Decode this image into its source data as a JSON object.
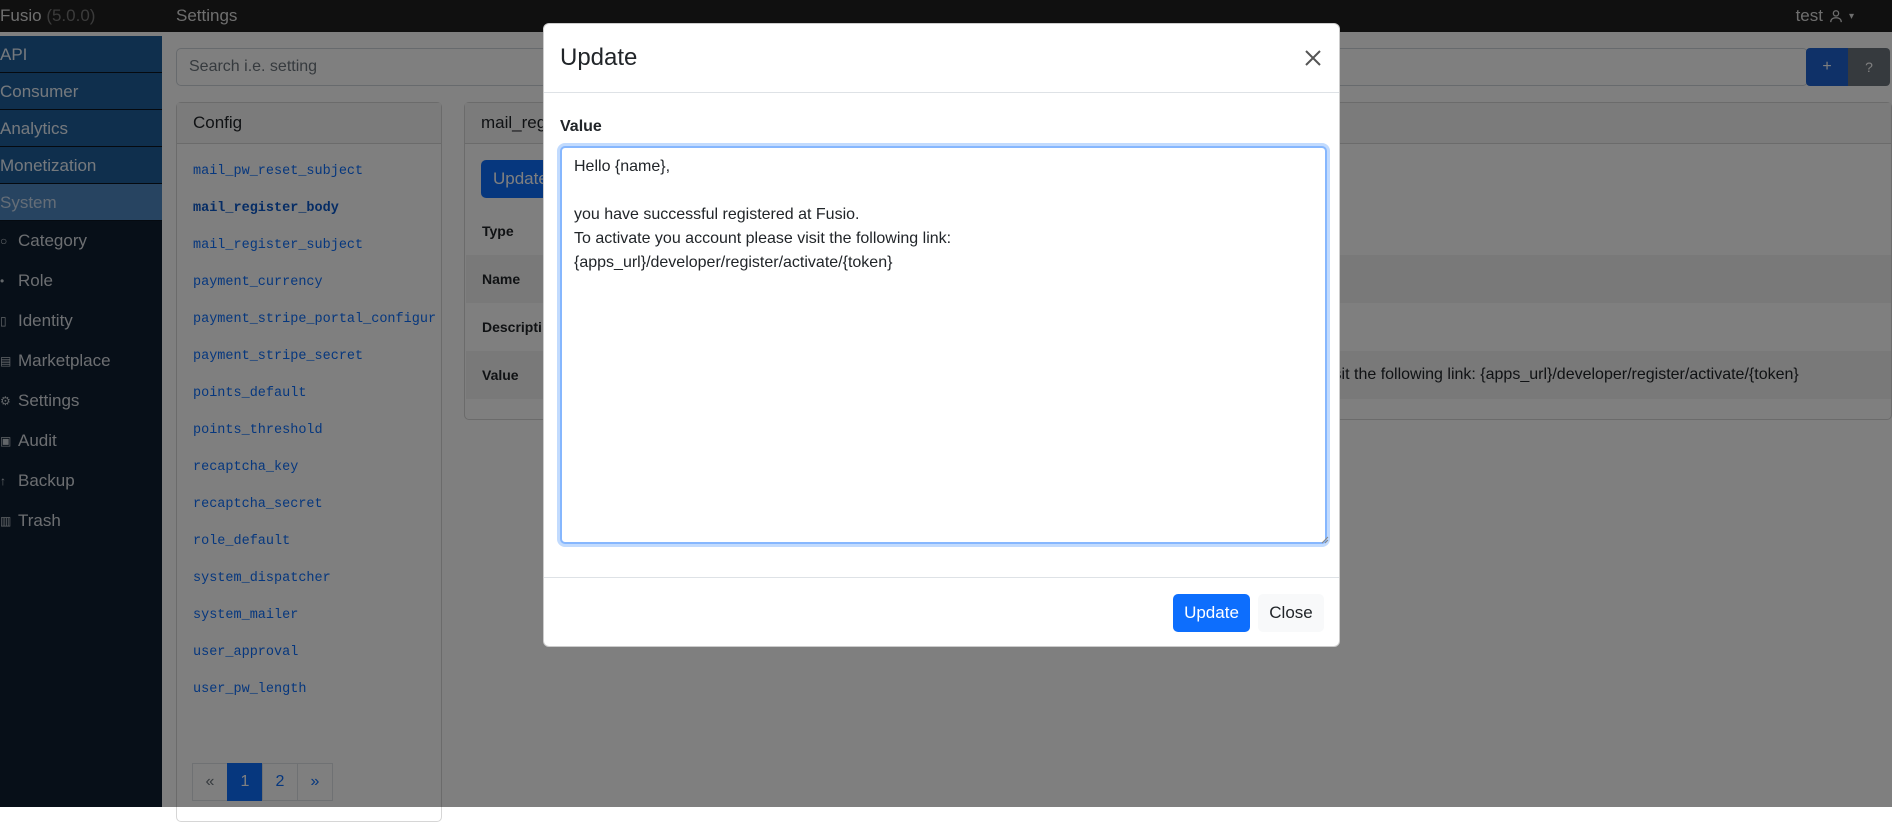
{
  "navbar": {
    "brand": "Fusio",
    "version": "(5.0.0)",
    "title": "Settings",
    "user": "test"
  },
  "sidebar": {
    "categories": [
      {
        "label": "API"
      },
      {
        "label": "Consumer"
      },
      {
        "label": "Analytics"
      },
      {
        "label": "Monetization"
      },
      {
        "label": "System",
        "active": true
      }
    ],
    "items": [
      {
        "label": "Category",
        "icon": "category-icon"
      },
      {
        "label": "Role",
        "icon": "role-icon"
      },
      {
        "label": "Identity",
        "icon": "identity-icon"
      },
      {
        "label": "Marketplace",
        "icon": "marketplace-icon"
      },
      {
        "label": "Settings",
        "icon": "gear-icon"
      },
      {
        "label": "Audit",
        "icon": "audit-icon"
      },
      {
        "label": "Backup",
        "icon": "backup-icon"
      },
      {
        "label": "Trash",
        "icon": "trash-icon"
      }
    ]
  },
  "toolbar": {
    "search_placeholder": "Search i.e. setting",
    "add_label": "+",
    "help_label": "?"
  },
  "config": {
    "header": "Config",
    "items": [
      "mail_pw_reset_subject",
      "mail_register_body",
      "mail_register_subject",
      "payment_currency",
      "payment_stripe_portal_configur",
      "payment_stripe_secret",
      "points_default",
      "points_threshold",
      "recaptcha_key",
      "recaptcha_secret",
      "role_default",
      "system_dispatcher",
      "system_mailer",
      "user_approval",
      "user_pw_length"
    ],
    "active_item": "mail_register_body",
    "pagination": {
      "prev": "«",
      "pages": [
        "1",
        "2"
      ],
      "current": "1",
      "next": "»"
    }
  },
  "detail": {
    "header": "mail_reg",
    "update_label": "Update",
    "rows": [
      {
        "label": "Type",
        "value": ""
      },
      {
        "label": "Name",
        "value": ""
      },
      {
        "label": "Descripti",
        "value": ""
      },
      {
        "label": "Value",
        "value": "isit the following link: {apps_url}/developer/register/activate/{token}"
      }
    ]
  },
  "modal": {
    "title": "Update",
    "value_label": "Value",
    "textarea_value": "Hello {name},\n\nyou have successful registered at Fusio.\nTo activate you account please visit the following link:\n{apps_url}/developer/register/activate/{token}",
    "update_button": "Update",
    "close_button": "Close"
  },
  "colors": {
    "primary": "#0d6efd",
    "sidebar_bg": "#0f1f30",
    "sidebar_category": "#1f5f9b",
    "navbar_bg": "#212121"
  }
}
